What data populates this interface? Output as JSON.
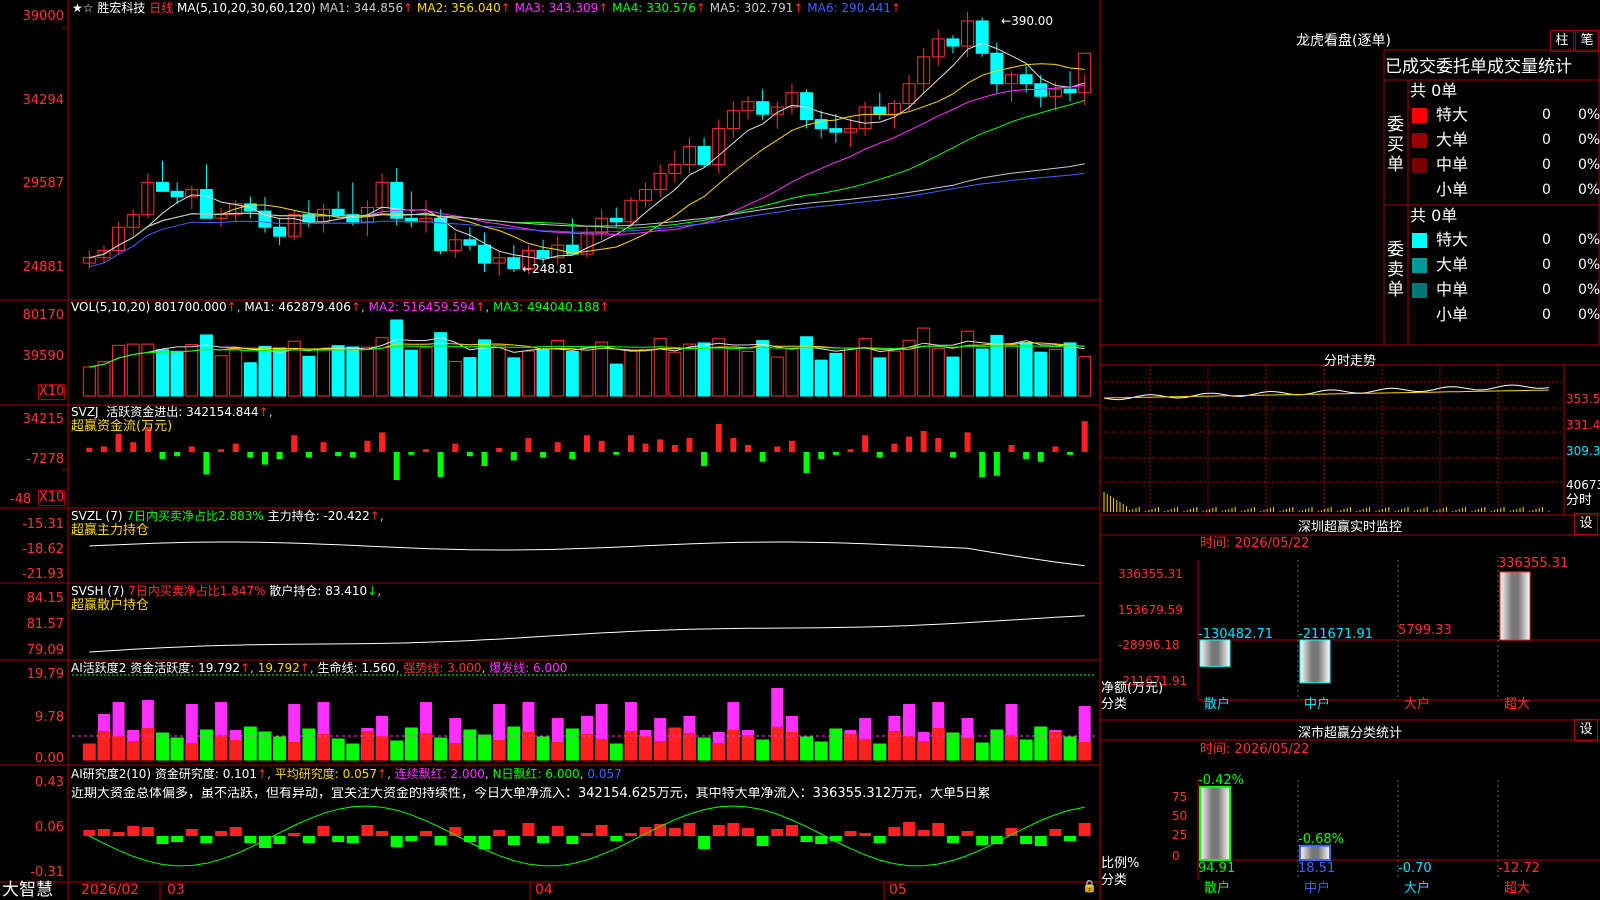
{
  "stock": {
    "name": "胜宏科技",
    "period": "日线",
    "ma_header": "MA(5,10,20,30,60,120)",
    "ma_items": [
      {
        "label": "MA1: 344.856",
        "arrow": "↑",
        "color": "#c8c8c8"
      },
      {
        "label": "MA2: 356.040",
        "arrow": "↑",
        "color": "#ffd700"
      },
      {
        "label": "MA3: 343.309",
        "arrow": "↑",
        "color": "#ff30ff"
      },
      {
        "label": "MA4: 330.576",
        "arrow": "↑",
        "color": "#00ff00"
      },
      {
        "label": "MA5: 302.791",
        "arrow": "↑",
        "color": "#c8c8c8"
      },
      {
        "label": "MA6: 290.441",
        "arrow": "↑",
        "color": "#4060ff"
      }
    ],
    "high_label": "390.00",
    "low_label": "248.81",
    "axis": [
      "39000",
      "34294",
      "29587",
      "24881"
    ]
  },
  "volume": {
    "header": "VOL(5,10,20)",
    "value": "801700.000",
    "ma1": "MA1: 462879.406",
    "ma2": "MA2: 516459.594",
    "ma3": "MA3: 494040.188",
    "axis": [
      "80170",
      "39590"
    ],
    "multiplier": "X10"
  },
  "svzj": {
    "header": "SVZJ",
    "label": "活跃资金进出: 342154.844",
    "subtitle": "超赢资金流(万元)",
    "axis": [
      "34215",
      "-7278",
      "-48"
    ],
    "multiplier": "X10"
  },
  "svzl": {
    "header": "SVZL (7)",
    "label1": "7日内买卖净占比2.883%",
    "label2": "主力持仓: -20.422",
    "subtitle": "超赢主力持仓",
    "axis": [
      "-15.31",
      "-18.62",
      "-21.93"
    ]
  },
  "svsh": {
    "header": "SVSH (7)",
    "label1": "7日内买卖净占比1.847%",
    "label2": "散户持仓: 83.410",
    "subtitle": "超赢散户持仓",
    "axis": [
      "84.15",
      "81.57",
      "79.09"
    ]
  },
  "ai_active": {
    "header": "AI活跃度2",
    "label1": "资金活跃度: 19.792",
    "label2": "19.792",
    "label3": "生命线: 1.560",
    "label4": "强势线: 3.000",
    "label5": "爆发线: 6.000",
    "axis": [
      "19.79",
      "9.78",
      "0.00"
    ]
  },
  "ai_research": {
    "header": "AI研究度2(10)",
    "label1": "资金研究度: 0.101",
    "label2": "平均研究度: 0.057",
    "label3": "连续飘红: 2.000",
    "label4": "N日飘红: 6.000",
    "label5": "0.057",
    "description": "近期大资金总体偏多，虽不活跃，但有异动，宜关注大资金的持续性，今日大单净流入：342154.625万元，其中特大单净流入：336355.312万元，大单5日累",
    "axis": [
      "0.43",
      "0.06",
      "-0.31"
    ]
  },
  "time_axis": {
    "brand": "大智慧",
    "labels": [
      "2026/02",
      "03",
      "04",
      "05"
    ]
  },
  "dragon": {
    "title": "龙虎看盘(逐单)",
    "btn1": "柱",
    "btn2": "笔",
    "tabs": "已成交委托单成交量统计",
    "buy_label": "委买单",
    "sell_label": "委卖单",
    "buy_total": "共 0单",
    "sell_total": "共 0单",
    "buy_rows": [
      {
        "name": "特大",
        "count": "0",
        "pct": "0%",
        "color": "#ff0000"
      },
      {
        "name": "大单",
        "count": "0",
        "pct": "0%",
        "color": "#990000"
      },
      {
        "name": "中单",
        "count": "0",
        "pct": "0%",
        "color": "#770000"
      },
      {
        "name": "小单",
        "count": "0",
        "pct": "0%",
        "color": "#000000"
      }
    ],
    "sell_rows": [
      {
        "name": "特大",
        "count": "0",
        "pct": "0%",
        "color": "#00ffff"
      },
      {
        "name": "大单",
        "count": "0",
        "pct": "0%",
        "color": "#009999"
      },
      {
        "name": "中单",
        "count": "0",
        "pct": "0%",
        "color": "#007777"
      },
      {
        "name": "小单",
        "count": "0",
        "pct": "0%",
        "color": "#000000"
      }
    ]
  },
  "intraday": {
    "title": "分时走势",
    "axis": [
      "353.5",
      "331.4",
      "309.3"
    ],
    "vol_label": "40673",
    "footer": "分时"
  },
  "sz_monitor": {
    "title": "深圳超赢实时监控",
    "time": "时间: 2026/05/22",
    "btn": "设",
    "axis": [
      "336355.31",
      "153679.59",
      "-28996.18",
      "-211671.91"
    ],
    "net_label": "净额(万元)",
    "cat_label": "分类",
    "bars": [
      {
        "cat": "散户",
        "value": "-130482.71",
        "num": -130482.71
      },
      {
        "cat": "中户",
        "value": "-211671.91",
        "num": -211671.91
      },
      {
        "cat": "大户",
        "value": "5799.33",
        "num": 5799.33
      },
      {
        "cat": "超大",
        "value": "336355.31",
        "num": 336355.31
      }
    ]
  },
  "sz_classify": {
    "title": "深市超赢分类统计",
    "time": "时间: 2026/05/22",
    "btn": "设",
    "axis": [
      "75",
      "50",
      "25",
      "0"
    ],
    "ratio_label": "比例%",
    "cat_label": "分类",
    "bars": [
      {
        "cat": "散户",
        "top": "-0.42%",
        "bottom": "94.91",
        "num": 94.91
      },
      {
        "cat": "中户",
        "top": "-0.68%",
        "bottom": "18.51",
        "num": 18.51
      },
      {
        "cat": "大户",
        "top": "",
        "bottom": "-0.70",
        "num": 0
      },
      {
        "cat": "超大",
        "top": "",
        "bottom": "-12.72",
        "num": 0
      }
    ]
  },
  "colors": {
    "up": "#ff3030",
    "down": "#00ffff",
    "grid": "#aa0000",
    "axis_text": "#ff3333"
  },
  "chart_data": {
    "type": "candlestick",
    "title": "胜宏科技 日线",
    "ylim": [
      240,
      395
    ],
    "ohlc": [
      [
        255,
        262,
        252,
        258
      ],
      [
        258,
        265,
        255,
        262
      ],
      [
        262,
        278,
        260,
        275
      ],
      [
        275,
        285,
        270,
        282
      ],
      [
        282,
        305,
        280,
        300
      ],
      [
        300,
        312,
        295,
        295
      ],
      [
        295,
        300,
        288,
        292
      ],
      [
        292,
        298,
        285,
        296
      ],
      [
        296,
        310,
        280,
        280
      ],
      [
        280,
        286,
        275,
        282
      ],
      [
        282,
        290,
        278,
        288
      ],
      [
        288,
        292,
        280,
        284
      ],
      [
        284,
        292,
        272,
        275
      ],
      [
        275,
        280,
        265,
        270
      ],
      [
        270,
        284,
        268,
        282
      ],
      [
        282,
        290,
        275,
        278
      ],
      [
        278,
        288,
        272,
        285
      ],
      [
        285,
        295,
        280,
        282
      ],
      [
        282,
        300,
        276,
        278
      ],
      [
        278,
        290,
        270,
        286
      ],
      [
        286,
        305,
        282,
        300
      ],
      [
        300,
        308,
        276,
        280
      ],
      [
        280,
        295,
        275,
        278
      ],
      [
        278,
        290,
        272,
        280
      ],
      [
        280,
        285,
        260,
        262
      ],
      [
        262,
        272,
        258,
        268
      ],
      [
        268,
        275,
        262,
        265
      ],
      [
        265,
        272,
        250,
        255
      ],
      [
        255,
        262,
        248,
        258
      ],
      [
        258,
        265,
        250,
        252
      ],
      [
        252,
        265,
        249,
        262
      ],
      [
        262,
        268,
        255,
        258
      ],
      [
        258,
        270,
        254,
        265
      ],
      [
        265,
        280,
        262,
        260
      ],
      [
        260,
        275,
        258,
        272
      ],
      [
        272,
        285,
        268,
        280
      ],
      [
        280,
        286,
        275,
        278
      ],
      [
        278,
        292,
        275,
        290
      ],
      [
        290,
        300,
        286,
        296
      ],
      [
        296,
        310,
        292,
        305
      ],
      [
        305,
        318,
        300,
        310
      ],
      [
        310,
        325,
        305,
        320
      ],
      [
        320,
        325,
        308,
        310
      ],
      [
        310,
        335,
        305,
        330
      ],
      [
        330,
        345,
        325,
        340
      ],
      [
        340,
        348,
        335,
        345
      ],
      [
        345,
        352,
        335,
        338
      ],
      [
        338,
        345,
        330,
        342
      ],
      [
        342,
        355,
        338,
        350
      ],
      [
        350,
        352,
        330,
        335
      ],
      [
        335,
        340,
        325,
        330
      ],
      [
        330,
        338,
        322,
        328
      ],
      [
        328,
        336,
        320,
        330
      ],
      [
        330,
        345,
        326,
        342
      ],
      [
        342,
        350,
        335,
        338
      ],
      [
        338,
        346,
        330,
        344
      ],
      [
        344,
        360,
        340,
        355
      ],
      [
        355,
        375,
        350,
        370
      ],
      [
        370,
        385,
        365,
        380
      ],
      [
        380,
        382,
        372,
        376
      ],
      [
        376,
        395,
        370,
        390
      ],
      [
        390,
        392,
        370,
        372
      ],
      [
        372,
        378,
        350,
        355
      ],
      [
        355,
        362,
        345,
        360
      ],
      [
        360,
        365,
        350,
        355
      ],
      [
        355,
        360,
        342,
        348
      ],
      [
        348,
        356,
        340,
        352
      ],
      [
        352,
        362,
        345,
        350
      ],
      [
        350,
        360,
        343,
        372
      ]
    ]
  }
}
